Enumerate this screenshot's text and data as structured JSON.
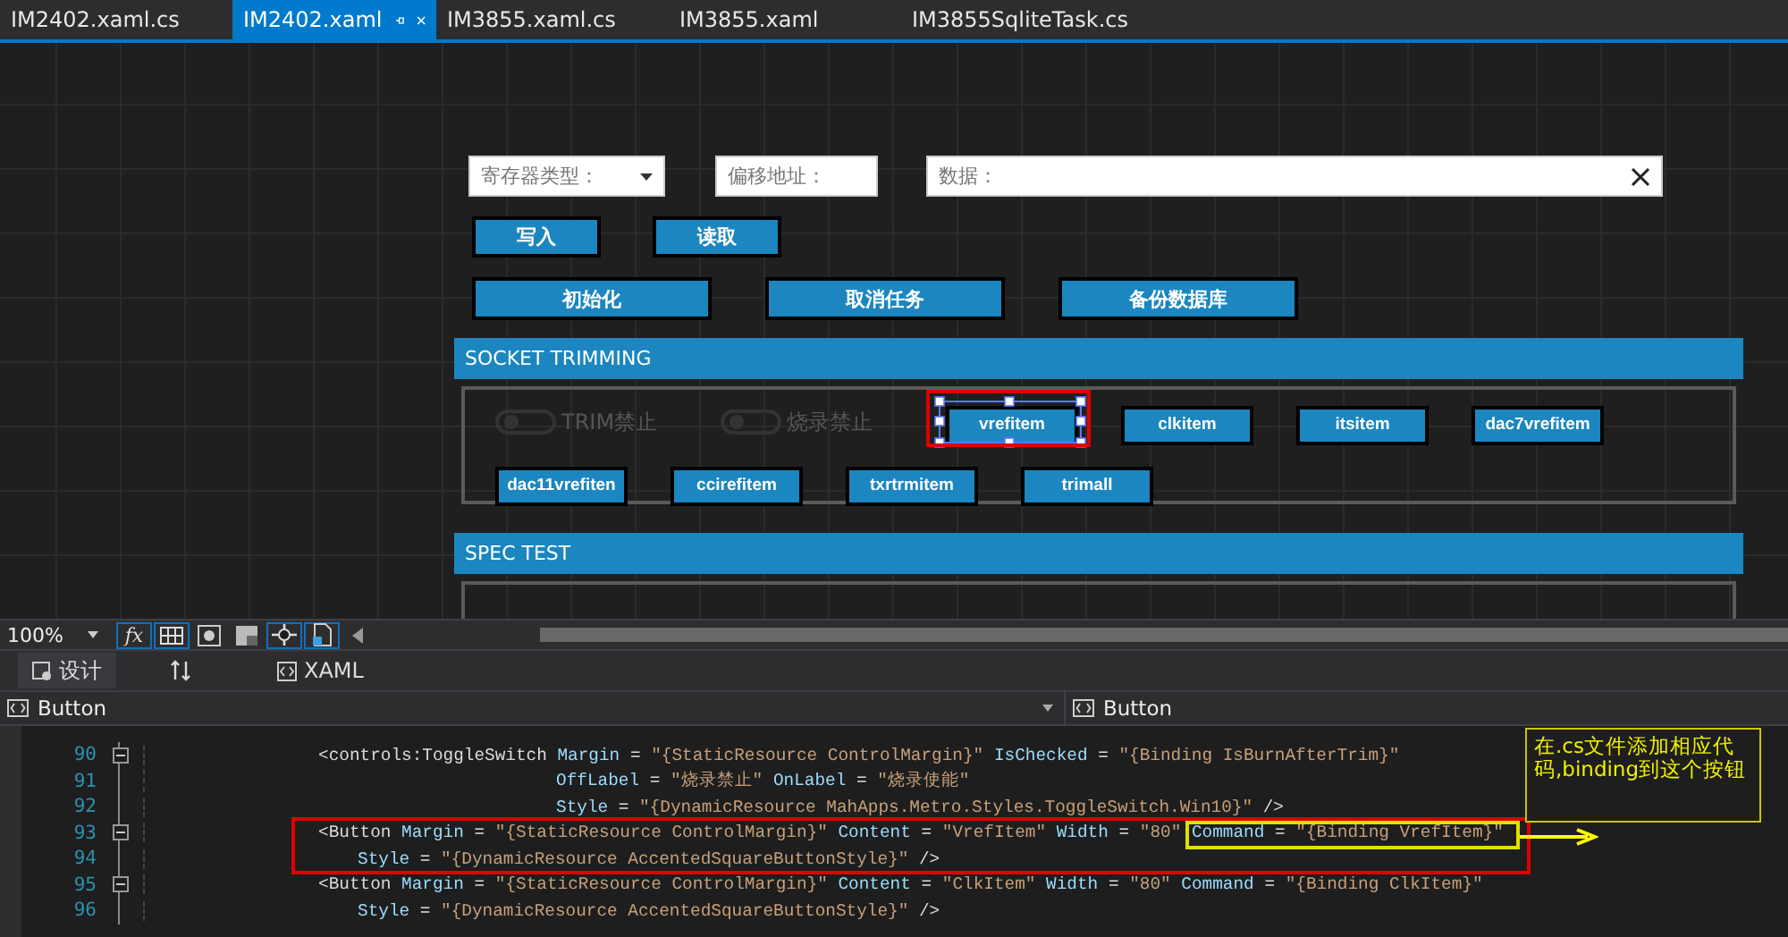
{
  "tabs": [
    {
      "label": "IM2402.xaml.cs",
      "selected": false
    },
    {
      "label": "IM2402.xaml",
      "selected": true
    },
    {
      "label": "IM3855.xaml.cs",
      "selected": false
    },
    {
      "label": "IM3855.xaml",
      "selected": false
    },
    {
      "label": "IM3855SqliteTask.cs",
      "selected": false
    }
  ],
  "designer": {
    "fields": [
      {
        "kind": "dropdown",
        "placeholder": "寄存器类型："
      },
      {
        "kind": "text",
        "placeholder": "偏移地址："
      },
      {
        "kind": "clearable",
        "placeholder": "数据："
      }
    ],
    "action_rows": [
      [
        {
          "label": "写入"
        },
        {
          "label": "读取"
        }
      ],
      [
        {
          "label": "初始化"
        },
        {
          "label": "取消任务"
        },
        {
          "label": "备份数据库"
        }
      ]
    ],
    "sections": [
      {
        "title": "SOCKET TRIMMING",
        "items": [
          {
            "kind": "toggle",
            "label": "TRIM禁止",
            "on": false
          },
          {
            "kind": "toggle",
            "label": "烧录禁止",
            "on": false
          },
          {
            "kind": "button",
            "label": "vrefitem",
            "selected": true
          },
          {
            "kind": "button",
            "label": "clkitem",
            "selected": false
          },
          {
            "kind": "button",
            "label": "itsitem",
            "selected": false
          },
          {
            "kind": "button",
            "label": "dac7vrefitem",
            "selected": false
          },
          {
            "kind": "button",
            "label": "dac11vrefiten",
            "selected": false
          },
          {
            "kind": "button",
            "label": "ccirefitem",
            "selected": false
          },
          {
            "kind": "button",
            "label": "txrtrmitem",
            "selected": false
          },
          {
            "kind": "button",
            "label": "trimall",
            "selected": false
          }
        ]
      },
      {
        "title": "SPEC TEST"
      }
    ]
  },
  "zoom_bar": {
    "zoom": "100%",
    "tools": [
      {
        "kind": "formula",
        "label": "fx",
        "on": true
      },
      {
        "kind": "grid",
        "on": true
      },
      {
        "kind": "snap",
        "on": false
      },
      {
        "kind": "checker",
        "on": false
      },
      {
        "kind": "crosshair",
        "on": true
      },
      {
        "kind": "document",
        "on": true
      }
    ]
  },
  "view_tabs": [
    {
      "label": "设计",
      "selected": true
    },
    {
      "label": "XAML",
      "selected": false
    }
  ],
  "breadcrumbs": [
    "Button",
    "Button"
  ],
  "code_lines": [
    {
      "number": "90",
      "kind": "tag",
      "fold": true,
      "text": "<controls:ToggleSwitch Margin = \"{StaticResource ControlMargin}\" IsChecked = \"{Binding IsBurnAfterTrim}\""
    },
    {
      "number": "91",
      "kind": "deep",
      "text": "OffLabel = \"烧录禁止\" OnLabel = \"烧录使能\""
    },
    {
      "number": "92",
      "kind": "deep",
      "text": "Style = \"{DynamicResource MahApps.Metro.Styles.ToggleSwitch.Win10}\" />"
    },
    {
      "number": "93",
      "kind": "tag",
      "fold": true,
      "text": "<Button Margin = \"{StaticResource ControlMargin}\" Content = \"VrefItem\" Width = \"80\" Command = \"{Binding VrefItem}\""
    },
    {
      "number": "94",
      "kind": "short",
      "text": "Style = \"{DynamicResource AccentedSquareButtonStyle}\" />"
    },
    {
      "number": "95",
      "kind": "tag",
      "fold": true,
      "text": "<Button Margin = \"{StaticResource ControlMargin}\" Content = \"ClkItem\" Width = \"80\" Command = \"{Binding ClkItem}\""
    },
    {
      "number": "96",
      "kind": "short",
      "text": "Style = \"{DynamicResource AccentedSquareButtonStyle}\" />"
    }
  ],
  "annotation": {
    "note": "在.cs文件添加相应代码,binding到这个按钮"
  }
}
